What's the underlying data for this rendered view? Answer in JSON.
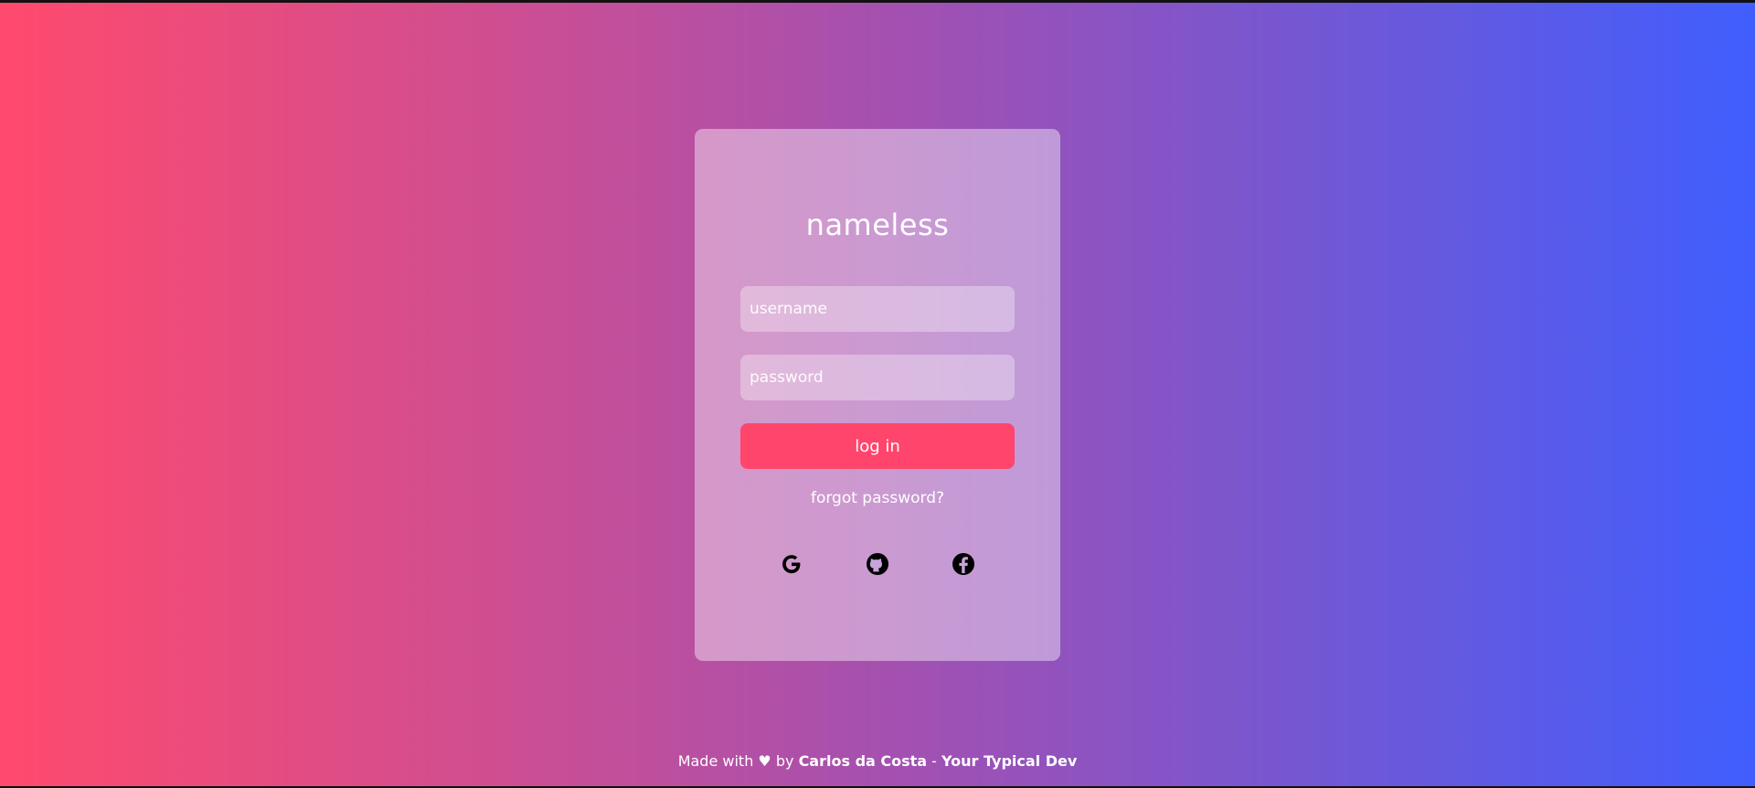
{
  "login": {
    "title": "nameless",
    "username_placeholder": "username",
    "password_placeholder": "password",
    "button_label": "log in",
    "forgot_label": "forgot password?"
  },
  "social": [
    {
      "name": "google",
      "icon": "google-icon"
    },
    {
      "name": "github",
      "icon": "github-icon"
    },
    {
      "name": "facebook",
      "icon": "facebook-icon"
    }
  ],
  "footer": {
    "prefix": "Made with ♥ by ",
    "author": "Carlos da Costa",
    "separator": " - ",
    "brand": "Your Typical Dev"
  },
  "colors": {
    "gradient_start": "#ff4a6d",
    "gradient_end": "#405efe",
    "button": "#ff456c",
    "text": "#ffffff"
  }
}
